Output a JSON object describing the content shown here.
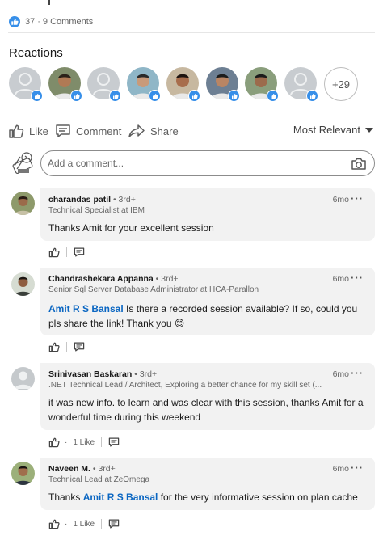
{
  "social": {
    "reactions_count": "37",
    "separator": "·",
    "comments_count": "9 Comments"
  },
  "reactions": {
    "title": "Reactions",
    "more_label": "+29",
    "avatars": [
      {
        "kind": "placeholder"
      },
      {
        "kind": "photo",
        "skin": "#b07a55",
        "bg": "#7f8c6a",
        "hair": "#2b2119"
      },
      {
        "kind": "placeholder"
      },
      {
        "kind": "photo",
        "skin": "#c89a7a",
        "bg": "#8fb6c7",
        "hair": "#2a2a2a"
      },
      {
        "kind": "photo",
        "skin": "#a86d4c",
        "bg": "#c7b8a0",
        "hair": "#1e1410"
      },
      {
        "kind": "photo",
        "skin": "#b98564",
        "bg": "#6d7f93",
        "hair": "#1c1c1c"
      },
      {
        "kind": "photo",
        "skin": "#9c6b4c",
        "bg": "#8a9e7c",
        "hair": "#1b1b1b"
      },
      {
        "kind": "placeholder"
      }
    ]
  },
  "actions": {
    "like": "Like",
    "comment": "Comment",
    "share": "Share",
    "sort": "Most Relevant"
  },
  "composer": {
    "placeholder": "Add a comment..."
  },
  "comments": [
    {
      "name": "charandas patil",
      "degree": " • 3rd+",
      "headline": "Technical Specialist at IBM",
      "time": "6mo",
      "text": "Thanks Amit for your excellent session",
      "like_count": ""
    },
    {
      "name": "Chandrashekara Appanna",
      "degree": " • 3rd+",
      "headline": "Senior Sql Server Database Administrator at HCA-Parallon",
      "time": "6mo",
      "mention": "Amit R S Bansal",
      "text": " Is there a recorded session available? If so, could you pls share the link! Thank you 😊",
      "like_count": ""
    },
    {
      "name": "Srinivasan Baskaran",
      "degree": " • 3rd+",
      "headline": ".NET Technical Lead / Architect, Exploring a better chance for my skill set (...",
      "time": "6mo",
      "text": "it was new info. to learn and was clear with this session, thanks Amit for a wonderful time during this weekend",
      "like_count": "1 Like"
    },
    {
      "name": "Naveen M.",
      "degree": " • 3rd+",
      "headline": "Technical Lead at ZeOmega",
      "time": "6mo",
      "prefix": "Thanks ",
      "mention": "Amit R S Bansal",
      "text": " for the very informative session on plan cache",
      "like_count": "1 Like"
    }
  ],
  "ui": {
    "more_dots": "···",
    "dot_sep": "·"
  },
  "colors": {
    "accent": "#0a66c2",
    "reaction_blue": "#378fe9",
    "bubble": "#f2f2f2"
  }
}
